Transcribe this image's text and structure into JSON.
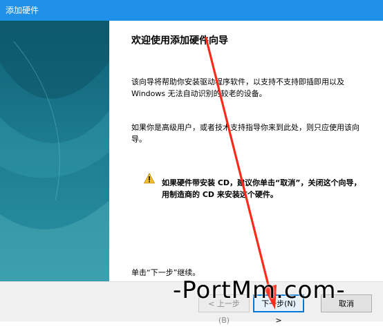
{
  "window": {
    "title": "添加硬件"
  },
  "wizard": {
    "heading": "欢迎使用添加硬件向导",
    "para1": "该向导将帮助你安装驱动程序软件，以支持不支持即插即用以及 Windows 无法自动识别的较老的设备。",
    "para2": "如果你是高级用户，或者技术支持指导你来到此处，则只应使用该向导。",
    "warning": "如果硬件带安装 CD，建议你单击“取消”，关闭这个向导，用制造商的 CD 来安装这个硬件。",
    "footer": "单击“下一步”继续。"
  },
  "buttons": {
    "back": "< 上一步(B)",
    "next": "下一步(N) >",
    "cancel": "取消"
  },
  "overlay": {
    "watermark": "-PortMm.com-",
    "arrow_color": "#ff2a1a"
  },
  "colors": {
    "titlebar": "#1e90e8",
    "sidebar": "#1a6f86"
  }
}
